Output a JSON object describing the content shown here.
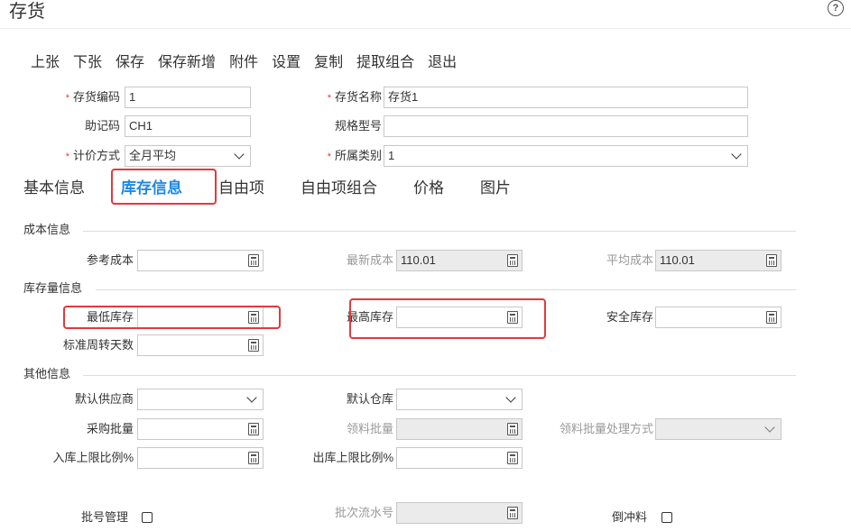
{
  "page": {
    "title": "存货",
    "help_icon": "question-circle-icon"
  },
  "toolbar": {
    "buttons": [
      "上张",
      "下张",
      "保存",
      "保存新增",
      "附件",
      "设置",
      "复制",
      "提取组合",
      "退出"
    ]
  },
  "header_form": {
    "code": {
      "label": "存货编码",
      "required": true,
      "value": "1"
    },
    "name": {
      "label": "存货名称",
      "required": true,
      "value": "存货1"
    },
    "mnemonic": {
      "label": "助记码",
      "value": "CH1"
    },
    "spec": {
      "label": "规格型号",
      "value": ""
    },
    "pricing": {
      "label": "计价方式",
      "required": true,
      "value": "全月平均"
    },
    "category": {
      "label": "所属类别",
      "required": true,
      "value": "1"
    }
  },
  "tabs": [
    {
      "label": "基本信息",
      "active": false
    },
    {
      "label": "库存信息",
      "active": true
    },
    {
      "label": "自由项",
      "active": false
    },
    {
      "label": "自由项组合",
      "active": false
    },
    {
      "label": "价格",
      "active": false
    },
    {
      "label": "图片",
      "active": false
    }
  ],
  "sections": {
    "cost": {
      "title": "成本信息",
      "ref_cost": {
        "label": "参考成本",
        "value": ""
      },
      "latest_cost": {
        "label": "最新成本",
        "value": "110.01"
      },
      "avg_cost": {
        "label": "平均成本",
        "value": "110.01"
      }
    },
    "stock": {
      "title": "库存量信息",
      "min_stock": {
        "label": "最低库存",
        "value": ""
      },
      "max_stock": {
        "label": "最高库存",
        "value": ""
      },
      "safety_stock": {
        "label": "安全库存",
        "value": ""
      },
      "turnover_days": {
        "label": "标准周转天数",
        "value": ""
      }
    },
    "other": {
      "title": "其他信息",
      "supplier": {
        "label": "默认供应商",
        "value": ""
      },
      "warehouse": {
        "label": "默认仓库",
        "value": ""
      },
      "purchase_batch": {
        "label": "采购批量",
        "value": ""
      },
      "issue_batch": {
        "label": "领料批量",
        "value": ""
      },
      "issue_batch_method": {
        "label": "领料批量处理方式",
        "value": ""
      },
      "in_limit": {
        "label": "入库上限比例%",
        "value": ""
      },
      "out_limit": {
        "label": "出库上限比例%",
        "value": ""
      },
      "batch_mgmt": {
        "label": "批号管理",
        "checked": false
      },
      "batch_serial": {
        "label": "批次流水号",
        "value": ""
      },
      "backflush": {
        "label": "倒冲料",
        "checked": false
      }
    }
  },
  "colors": {
    "accent": "#1e88e5",
    "highlight": "#e4393c",
    "required": "#e4393c"
  }
}
